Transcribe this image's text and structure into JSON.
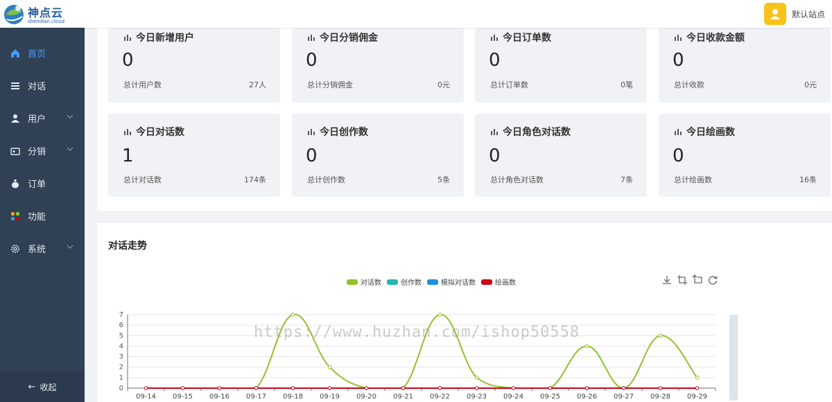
{
  "header": {
    "logo_text": "神点云",
    "logo_sub": "shendian.cloud",
    "site_name": "默认站点"
  },
  "sidebar": {
    "items": [
      {
        "label": "首页",
        "icon": "home-icon",
        "active": true,
        "expandable": false
      },
      {
        "label": "对话",
        "icon": "list-icon",
        "active": false,
        "expandable": false
      },
      {
        "label": "用户",
        "icon": "user-icon",
        "active": false,
        "expandable": true
      },
      {
        "label": "分销",
        "icon": "wallet-icon",
        "active": false,
        "expandable": true
      },
      {
        "label": "订单",
        "icon": "money-bag-icon",
        "active": false,
        "expandable": false
      },
      {
        "label": "功能",
        "icon": "apps-icon",
        "active": false,
        "expandable": false
      },
      {
        "label": "系统",
        "icon": "gear-icon",
        "active": false,
        "expandable": true
      }
    ],
    "collapse_label": "收起"
  },
  "stats": {
    "cards": [
      {
        "title": "今日新增用户",
        "value": "0",
        "total_label": "总计用户数",
        "total_value": "27人"
      },
      {
        "title": "今日分销佣金",
        "value": "0",
        "total_label": "总计分销佣金",
        "total_value": "0元"
      },
      {
        "title": "今日订单数",
        "value": "0",
        "total_label": "总计订单数",
        "total_value": "0笔"
      },
      {
        "title": "今日收款金额",
        "value": "0",
        "total_label": "总计收款",
        "total_value": "0元"
      },
      {
        "title": "今日对话数",
        "value": "1",
        "total_label": "总计对话数",
        "total_value": "174条"
      },
      {
        "title": "今日创作数",
        "value": "0",
        "total_label": "总计创作数",
        "total_value": "5条"
      },
      {
        "title": "今日角色对话数",
        "value": "0",
        "total_label": "总计角色对话数",
        "total_value": "7条"
      },
      {
        "title": "今日绘画数",
        "value": "0",
        "total_label": "总计绘画数",
        "total_value": "16条"
      }
    ]
  },
  "chart_panel": {
    "title": "对话走势"
  },
  "watermark": "https://www.huzhan.com/ishop50558",
  "colors": {
    "sidebar_bg": "#304156",
    "active": "#409eff",
    "avatar": "#f8c21a"
  },
  "chart_data": {
    "type": "line",
    "x": [
      "09-14",
      "09-15",
      "09-16",
      "09-17",
      "09-18",
      "09-19",
      "09-20",
      "09-21",
      "09-22",
      "09-23",
      "09-24",
      "09-25",
      "09-26",
      "09-27",
      "09-28",
      "09-29"
    ],
    "ylim": [
      0,
      7
    ],
    "yticks": [
      0,
      1,
      2,
      3,
      4,
      5,
      6,
      7
    ],
    "grid": true,
    "legend_position": "top-center",
    "series": [
      {
        "name": "对话数",
        "color": "#91c12b",
        "values": [
          0,
          0,
          0,
          0,
          7,
          2,
          0,
          0,
          7,
          1,
          0,
          0,
          4,
          0,
          5,
          1
        ]
      },
      {
        "name": "创作数",
        "color": "#26b7b0",
        "values": [
          0,
          0,
          0,
          0,
          0,
          0,
          0,
          0,
          0,
          0,
          0,
          0,
          0,
          0,
          0,
          0
        ]
      },
      {
        "name": "模拟对话数",
        "color": "#1e90dd",
        "values": [
          0,
          0,
          0,
          0,
          0,
          0,
          0,
          0,
          0,
          0,
          0,
          0,
          0,
          0,
          0,
          0
        ]
      },
      {
        "name": "绘画数",
        "color": "#d0021b",
        "values": [
          0,
          0,
          0,
          0,
          0,
          0,
          0,
          0,
          0,
          0,
          0,
          0,
          0,
          0,
          0,
          0
        ]
      }
    ]
  }
}
